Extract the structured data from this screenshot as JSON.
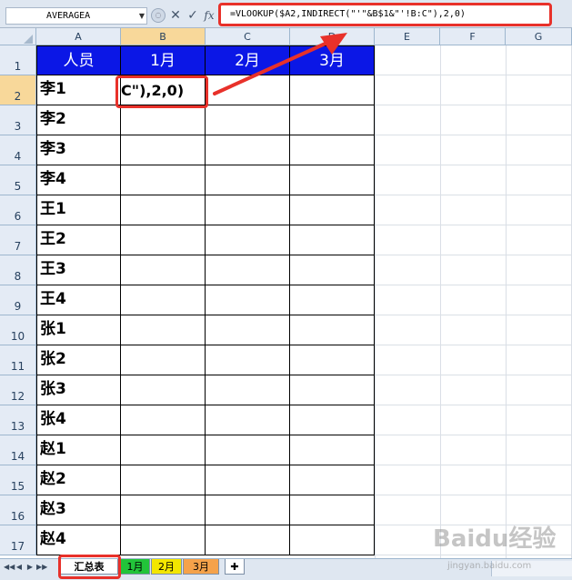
{
  "formula_bar": {
    "name_box": "AVERAGEA",
    "cancel_glyph": "✕",
    "enter_glyph": "✓",
    "fx_label": "fx",
    "formula": "=VLOOKUP($A2,INDIRECT(\"'\"&B$1&\"'!B:C\"),2,0)"
  },
  "columns": [
    "A",
    "B",
    "C",
    "D",
    "E",
    "F",
    "G"
  ],
  "rows": [
    "1",
    "2",
    "3",
    "4",
    "5",
    "6",
    "7",
    "8",
    "9",
    "10",
    "11",
    "12",
    "13",
    "14",
    "15",
    "16",
    "17"
  ],
  "table": {
    "headers": [
      "人员",
      "1月",
      "2月",
      "3月"
    ],
    "names": [
      "李1",
      "李2",
      "李3",
      "李4",
      "王1",
      "王2",
      "王3",
      "王4",
      "张1",
      "张2",
      "张3",
      "张4",
      "赵1",
      "赵2",
      "赵3",
      "赵4"
    ]
  },
  "active_cell_edit": "C\"),2,0)",
  "sheet_tabs": [
    "汇总表",
    "1月",
    "2月",
    "3月"
  ],
  "nav_glyphs": [
    "◀◀",
    "◀",
    "▶",
    "▶▶"
  ],
  "watermark": "Baidu经验",
  "watermark_sub": "jingyan.baidu.com",
  "colors": {
    "header_fill": "#0b17e6",
    "callout_red": "#e8312a",
    "tab_green": "#22c43a",
    "tab_yellow": "#f3e600",
    "tab_orange": "#f5a24a"
  }
}
